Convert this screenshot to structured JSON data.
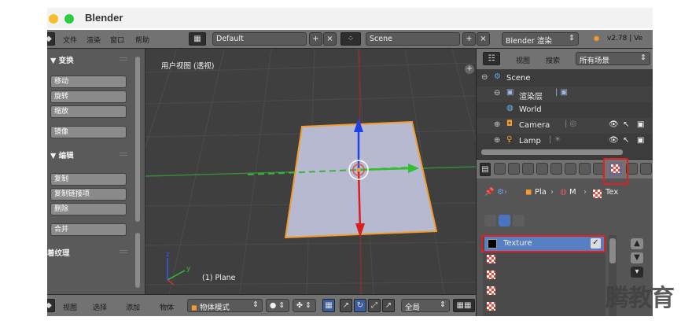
{
  "window": {
    "title": "Blender"
  },
  "info_header": {
    "menus": [
      "文件",
      "渲染",
      "窗口",
      "帮助"
    ],
    "screen_layout": "Default",
    "scene": "Scene",
    "render_engine": "Blender 渲染",
    "version": "v2.78 | Ve"
  },
  "tool_shelf": {
    "transform_title": "▼ 变换",
    "transform_buttons": [
      "移动",
      "旋转",
      "缩放",
      "镜像"
    ],
    "edit_title": "▼ 编辑",
    "edit_buttons": [
      "复制",
      "复制链接项",
      "删除",
      "合并"
    ],
    "shading_title": "着纹理"
  },
  "viewport": {
    "view_label": "用户视图 (透视)",
    "object_label": "(1) Plane",
    "plane_color": "#b7b9d0",
    "outline_color": "#f39c2c"
  },
  "viewport_header": {
    "menus": [
      "视图",
      "选择",
      "添加",
      "物体"
    ],
    "mode": "物体模式",
    "global": "全局"
  },
  "outliner": {
    "header_items": [
      "视图",
      "搜索"
    ],
    "filter": "所有场景",
    "rows": [
      {
        "label": "Scene",
        "icon": "scene-icon"
      },
      {
        "label": "渲染层",
        "icon": "render-layers-icon"
      },
      {
        "label": "World",
        "icon": "world-icon"
      },
      {
        "label": "Camera",
        "icon": "camera-icon"
      },
      {
        "label": "Lamp",
        "icon": "lamp-icon"
      }
    ]
  },
  "properties": {
    "breadcrumb": [
      "Pla",
      "M",
      "Tex"
    ],
    "texture_slots": [
      {
        "label": "Texture",
        "selected": true
      },
      {
        "label": "",
        "selected": false
      },
      {
        "label": "",
        "selected": false
      },
      {
        "label": "",
        "selected": false
      },
      {
        "label": "",
        "selected": false
      }
    ]
  },
  "watermark": "腾教育"
}
